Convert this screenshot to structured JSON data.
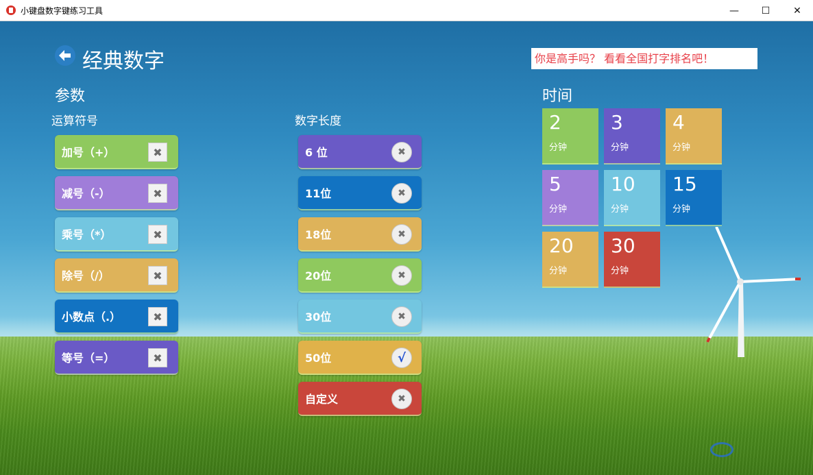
{
  "window": {
    "title": "小键盘数字键练习工具",
    "minimize": "—",
    "maximize": "☐",
    "close": "✕"
  },
  "header": {
    "title": "经典数字",
    "promo": "你是高手吗？ 看看全国打字排名吧！"
  },
  "params": {
    "section_title": "参数",
    "operators": {
      "title": "运算符号",
      "items": [
        {
          "label": "加号（+）",
          "color": "#8fc95e",
          "checked": false
        },
        {
          "label": "减号（-）",
          "color": "#a07dd9",
          "checked": false
        },
        {
          "label": "乘号（*）",
          "color": "#73c6e0",
          "checked": false
        },
        {
          "label": "除号（/）",
          "color": "#deb35a",
          "checked": false
        },
        {
          "label": "小数点（.）",
          "color": "#1273c2",
          "checked": false
        },
        {
          "label": "等号（=）",
          "color": "#6a5ac6",
          "checked": false
        }
      ]
    },
    "lengths": {
      "title": "数字长度",
      "items": [
        {
          "label": "6 位",
          "color": "#6a5ac6",
          "checked": false
        },
        {
          "label": "11位",
          "color": "#1273c2",
          "checked": false
        },
        {
          "label": "18位",
          "color": "#deb35a",
          "checked": false
        },
        {
          "label": "20位",
          "color": "#8fc95e",
          "checked": false
        },
        {
          "label": "30位",
          "color": "#73c6e0",
          "checked": false
        },
        {
          "label": "50位",
          "color": "#e0b24a",
          "checked": true
        },
        {
          "label": "自定义",
          "color": "#c9463b",
          "checked": false
        }
      ]
    }
  },
  "time": {
    "title": "时间",
    "tiles": [
      {
        "value": "2",
        "unit": "分钟",
        "color": "#8fc95e"
      },
      {
        "value": "3",
        "unit": "分钟",
        "color": "#6a5ac6"
      },
      {
        "value": "4",
        "unit": "分钟",
        "color": "#deb35a"
      },
      {
        "value": "5",
        "unit": "分钟",
        "color": "#a07dd9"
      },
      {
        "value": "10",
        "unit": "分钟",
        "color": "#73c6e0"
      },
      {
        "value": "15",
        "unit": "分钟",
        "color": "#1273c2"
      },
      {
        "value": "20",
        "unit": "分钟",
        "color": "#deb35a"
      },
      {
        "value": "30",
        "unit": "分钟",
        "color": "#c9463b"
      }
    ]
  },
  "icons": {
    "unchecked_box": "✖",
    "unchecked_circle": "✖",
    "checked_circle": "√"
  }
}
